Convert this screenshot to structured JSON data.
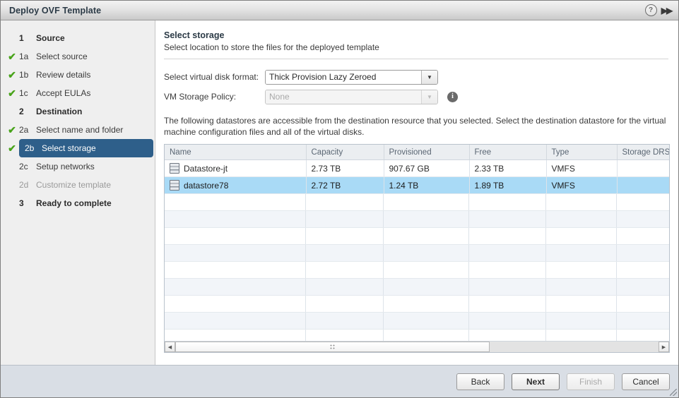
{
  "window": {
    "title": "Deploy OVF Template",
    "help_icon": "help-circle-icon",
    "collapse_icon": "double-chevron-right-icon"
  },
  "sidebar": {
    "items": [
      {
        "num": "1",
        "label": "Source",
        "state": "group",
        "check": false
      },
      {
        "num": "1a",
        "label": "Select source",
        "state": "done",
        "check": true
      },
      {
        "num": "1b",
        "label": "Review details",
        "state": "done",
        "check": true
      },
      {
        "num": "1c",
        "label": "Accept EULAs",
        "state": "done",
        "check": true
      },
      {
        "num": "2",
        "label": "Destination",
        "state": "group",
        "check": false
      },
      {
        "num": "2a",
        "label": "Select name and folder",
        "state": "done",
        "check": true
      },
      {
        "num": "2b",
        "label": "Select storage",
        "state": "selected",
        "check": true
      },
      {
        "num": "2c",
        "label": "Setup networks",
        "state": "normal",
        "check": false
      },
      {
        "num": "2d",
        "label": "Customize template",
        "state": "disabled",
        "check": false
      },
      {
        "num": "3",
        "label": "Ready to complete",
        "state": "group",
        "check": false
      }
    ],
    "check_glyph": "✔"
  },
  "content": {
    "heading": "Select storage",
    "subheading": "Select location to store the files for the deployed template",
    "description": "The following datastores are accessible from the destination resource that you selected. Select the destination datastore for the virtual machine configuration files and all of the virtual disks.",
    "form": {
      "disk_format_label": "Select virtual disk format:",
      "disk_format_value": "Thick Provision Lazy Zeroed",
      "storage_policy_label": "VM Storage Policy:",
      "storage_policy_value": "None",
      "info_glyph": "i",
      "arrow_glyph": "▼"
    },
    "table": {
      "columns": [
        "Name",
        "Capacity",
        "Provisioned",
        "Free",
        "Type",
        "Storage DRS"
      ],
      "rows": [
        {
          "name": "Datastore-jt",
          "capacity": "2.73 TB",
          "provisioned": "907.67 GB",
          "free": "2.33 TB",
          "type": "VMFS",
          "sdrs": "",
          "selected": false
        },
        {
          "name": "datastore78",
          "capacity": "2.72 TB",
          "provisioned": "1.24 TB",
          "free": "1.89 TB",
          "type": "VMFS",
          "sdrs": "",
          "selected": true
        }
      ]
    },
    "scrollbar": {
      "left_glyph": "◀",
      "right_glyph": "▶"
    }
  },
  "footer": {
    "buttons": [
      {
        "label": "Back",
        "state": "normal"
      },
      {
        "label": "Next",
        "state": "default"
      },
      {
        "label": "Finish",
        "state": "disabled"
      },
      {
        "label": "Cancel",
        "state": "normal"
      }
    ]
  },
  "colors": {
    "selection_nav": "#2e5f8a",
    "selection_row": "#a9daf6",
    "check_green": "#48a31a",
    "footer_band": "#d9dee5"
  }
}
